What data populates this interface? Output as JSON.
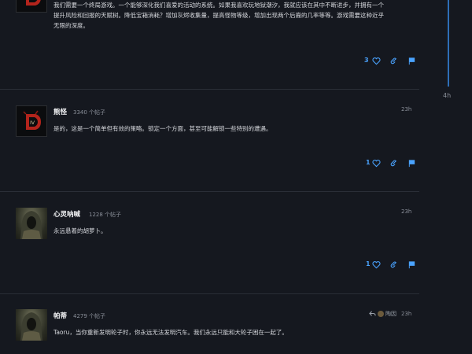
{
  "timeline": {
    "label": "4h"
  },
  "posts": [
    {
      "body_line1": "我们需要一个终局游戏。一个能够深化我们喜爱的活动的系统。如果我喜欢玩地狱潮汐，我就应该在其中不断进步，并拥有一个",
      "body_line2": "提升风险和回报的天赋树。降低宝箱消耗？增加灰烬收集量，提高怪物等级，增加出现两个后裔的几率等等。游戏需要这种近乎",
      "body_line3": "无限的深度。",
      "likes": "3"
    },
    {
      "username": "熊怪",
      "post_count": "3340 个帖子",
      "time": "23h",
      "body": "是的，这是一个简单但有效的策略。锁定一个方面，甚至可能解锁一些特别的遭遇。",
      "likes": "1",
      "avatar_icon": "diablo-iv-logo-icon"
    },
    {
      "username": "心灵呐喊",
      "post_count": "1228 个帖子",
      "time": "23h",
      "body": "永远悬着的胡萝卜。",
      "likes": "1",
      "avatar_icon": "hooded-figure-icon"
    },
    {
      "username": "帕蒂",
      "post_count": "4279 个帖子",
      "time": "23h",
      "reply_to": "陶因",
      "body": "Taoru，当你重新发明轮子时，你永远无法发明汽车。我们永远只能和大轮子困在一起了。",
      "avatar_icon": "hooded-figure-icon"
    }
  ],
  "colors": {
    "accent": "#4aa3ff",
    "background": "#15181f",
    "divider": "#2a2e37"
  }
}
